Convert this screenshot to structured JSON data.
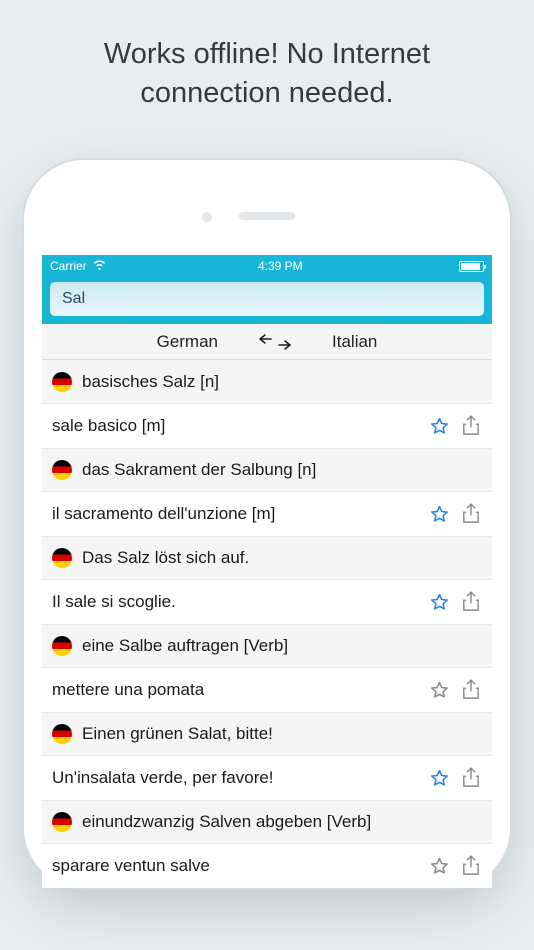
{
  "tagline_line1": "Works offline! No Internet",
  "tagline_line2": "connection needed.",
  "status": {
    "carrier": "Carrier",
    "time": "4:39 PM"
  },
  "search": {
    "value": "Sal"
  },
  "lang": {
    "left": "German",
    "right": "Italian"
  },
  "entries": [
    {
      "source": "basisches Salz [n]",
      "translation": "sale basico [m]",
      "starred": true
    },
    {
      "source": "das Sakrament der Salbung [n]",
      "translation": "il sacramento dell'unzione [m]",
      "starred": true
    },
    {
      "source": "Das Salz löst sich auf.",
      "translation": "Il sale si scoglie.",
      "starred": true
    },
    {
      "source": "eine Salbe auftragen [Verb]",
      "translation": "mettere una pomata",
      "starred": false
    },
    {
      "source": "Einen grünen Salat, bitte!",
      "translation": "Un'insalata verde, per favore!",
      "starred": true
    },
    {
      "source": "einundzwanzig Salven abgeben [Verb]",
      "translation": "sparare ventun salve",
      "starred": false
    }
  ]
}
